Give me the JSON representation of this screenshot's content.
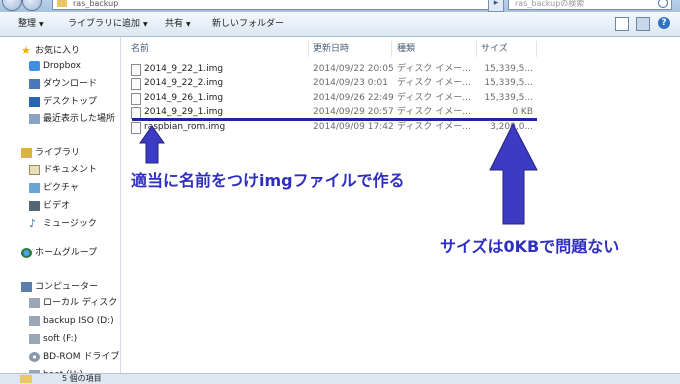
{
  "address": {
    "path": "ras_backup"
  },
  "search": {
    "placeholder": "ras_backupの検索"
  },
  "toolbar": {
    "organize": "整理",
    "add_to_library": "ライブラリに追加",
    "share": "共有",
    "new_folder": "新しいフォルダー"
  },
  "sidebar": {
    "favorites": {
      "label": "お気に入り",
      "items": [
        "Dropbox",
        "ダウンロード",
        "デスクトップ",
        "最近表示した場所"
      ]
    },
    "libraries": {
      "label": "ライブラリ",
      "items": [
        "ドキュメント",
        "ピクチャ",
        "ビデオ",
        "ミュージック"
      ]
    },
    "homegroup": "ホームグループ",
    "computer": {
      "label": "コンピューター",
      "items": [
        "ローカル ディスク",
        "backup ISO (D:)",
        "soft (F:)",
        "BD-ROM ドライブ",
        "boot (H:)"
      ]
    }
  },
  "columns": {
    "name": "名前",
    "date": "更新日時",
    "type": "種類",
    "size": "サイズ"
  },
  "files": [
    {
      "name": "2014_9_22_1.img",
      "date": "2014/09/22 20:05",
      "type": "ディスク イメー...",
      "size": "15,339,5..."
    },
    {
      "name": "2014_9_22_2.img",
      "date": "2014/09/23 0:01",
      "type": "ディスク イメー...",
      "size": "15,339,5..."
    },
    {
      "name": "2014_9_26_1.img",
      "date": "2014/09/26 22:49",
      "type": "ディスク イメー...",
      "size": "15,339,5..."
    },
    {
      "name": "2014_9_29_1.img",
      "date": "2014/09/29 20:57",
      "type": "ディスク イメー...",
      "size": "0 KB"
    },
    {
      "name": "raspbian_rom.img",
      "date": "2014/09/09 17:42",
      "type": "ディスク イメー...",
      "size": "3,200,0..."
    }
  ],
  "annotations": {
    "left_text": "適当に名前をつけimgファイルで作る",
    "right_text": "サイズは0KBで問題ない",
    "color": "#2f2fbf"
  },
  "status": {
    "count": "5 個の項目"
  }
}
